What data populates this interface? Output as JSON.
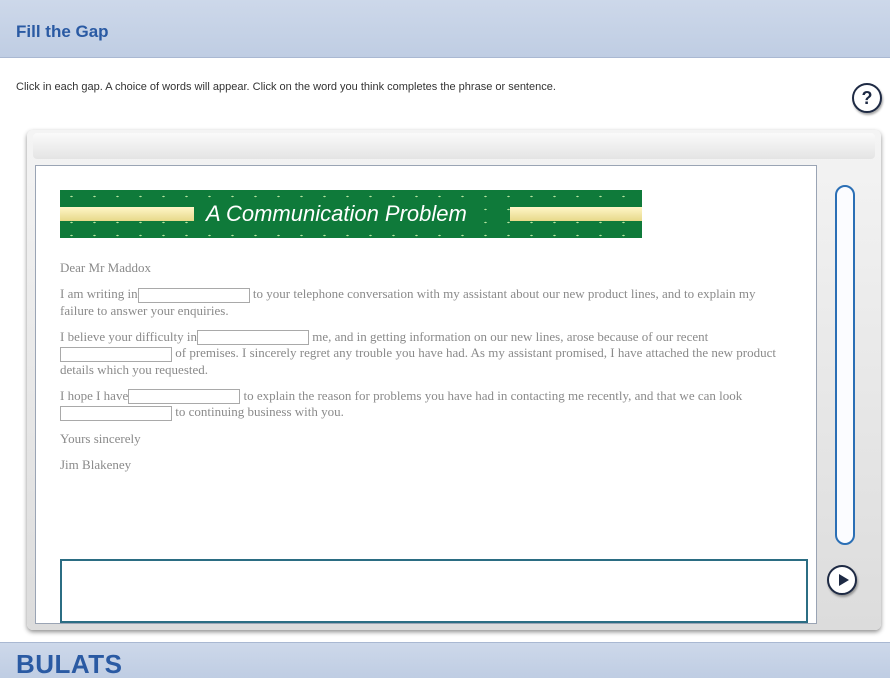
{
  "header": {
    "title": "Fill the Gap"
  },
  "instructions": "Click in each gap. A choice of words will appear. Click on the word you think completes the phrase or sentence.",
  "help_icon": "?",
  "banner": {
    "title": "A Communication Problem"
  },
  "letter": {
    "greeting": "Dear Mr Maddox",
    "p1": {
      "s1": "I am writing in",
      "s2": " to your telephone conversation with my assistant about our new product lines, and to explain my failure to answer your enquiries."
    },
    "p2": {
      "s1": "I believe your difficulty in",
      "s2": " me, and in getting information on our new lines, arose because of our recent",
      "s3": " of premises. I sincerely regret any trouble you have had. As my assistant promised, I have attached the new product details which you requested."
    },
    "p3": {
      "s1": "I hope I have",
      "s2": " to explain the reason for problems you have had in contacting me recently, and that we can look",
      "s3": " to continuing business with you."
    },
    "closing": "Yours sincerely",
    "signature": "Jim Blakeney"
  },
  "footer": {
    "brand": "BULATS"
  },
  "colors": {
    "header_bg": "#c7d3e7",
    "title_blue": "#2a5aa3",
    "banner_green": "#0f7a3a"
  }
}
